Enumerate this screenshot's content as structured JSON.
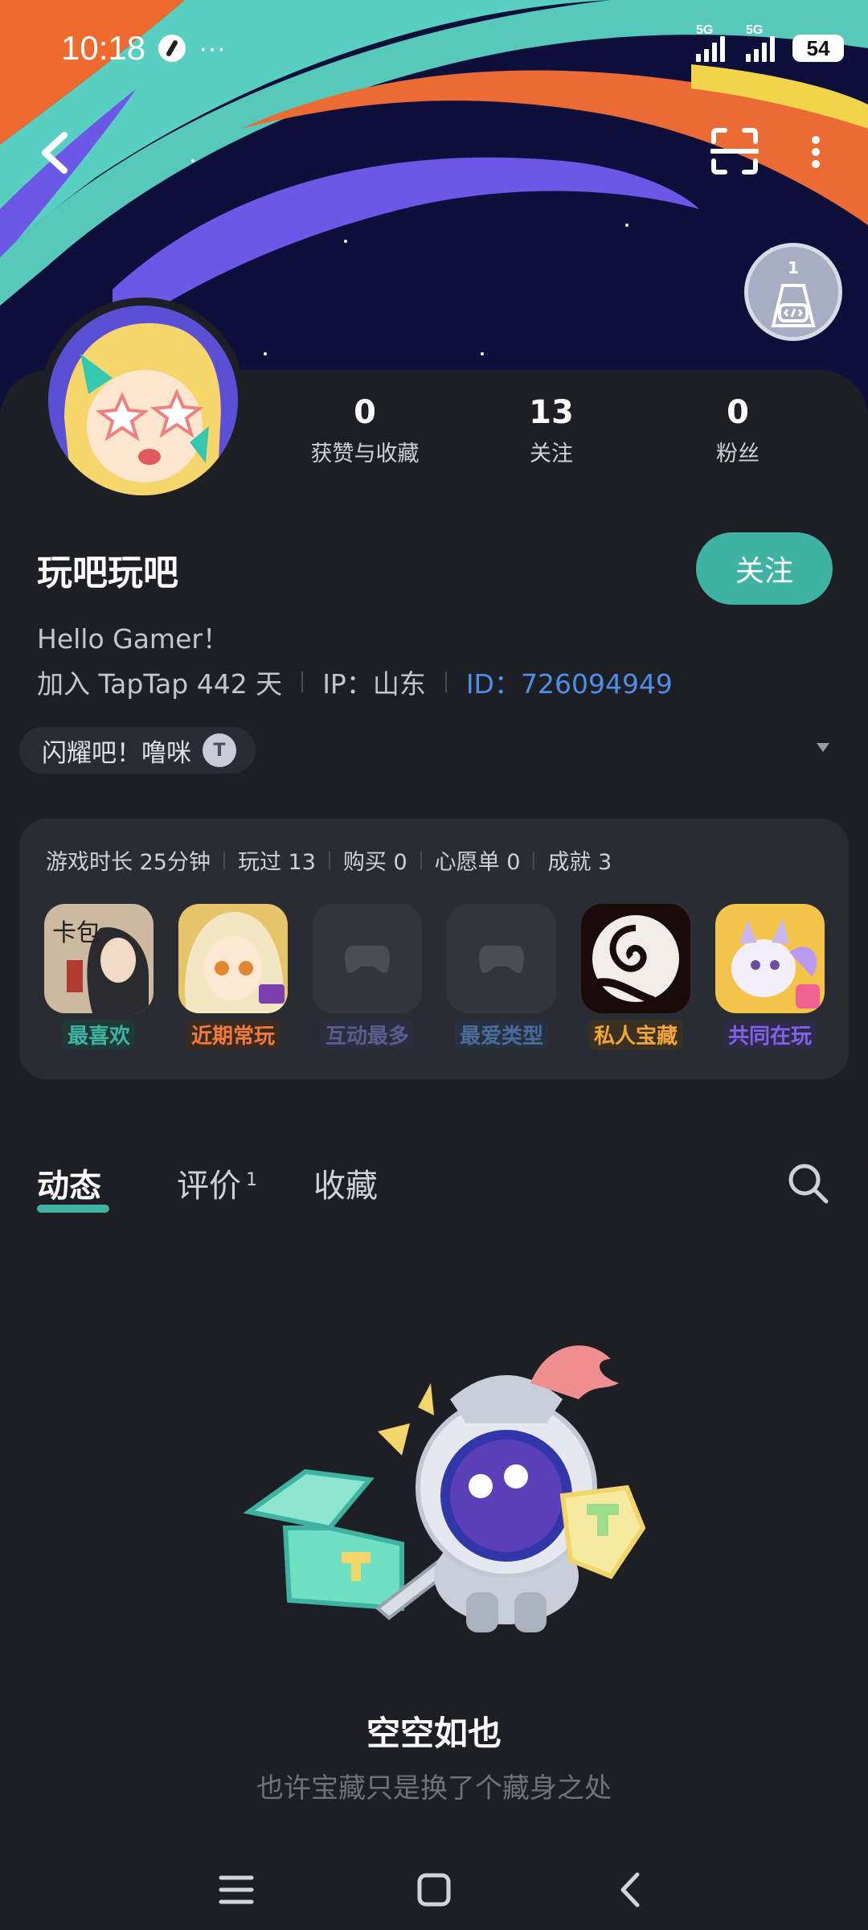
{
  "status_bar": {
    "time": "10:18",
    "more": "···",
    "sim1_tag": "5G",
    "sim2_tag": "5G",
    "battery": "54"
  },
  "badge": {
    "level": "1"
  },
  "stats": [
    {
      "value": "0",
      "label": "获赞与收藏"
    },
    {
      "value": "13",
      "label": "关注"
    },
    {
      "value": "0",
      "label": "粉丝"
    }
  ],
  "profile": {
    "name": "玩吧玩吧",
    "follow_label": "关注",
    "bio": "Hello Gamer！",
    "joined": "加入 TapTap 442 天",
    "ip": "IP：山东",
    "id": "ID：726094949",
    "title_pill": "闪耀吧！噜咪",
    "title_icon": "T"
  },
  "games_panel": {
    "stats": [
      "游戏时长 25分钟",
      "玩过 13",
      "购买 0",
      "心愿单 0",
      "成就 3"
    ],
    "items": [
      {
        "label": "最喜欢",
        "color": "#3fb3a2",
        "bg": "#1f3a36"
      },
      {
        "label": "近期常玩",
        "color": "#f07a3c",
        "bg": "#3a2a22"
      },
      {
        "label": "互动最多",
        "color": "#5a5d8c",
        "bg": "#2c2e3f"
      },
      {
        "label": "最爱类型",
        "color": "#4b6b9a",
        "bg": "#27303f"
      },
      {
        "label": "私人宝藏",
        "color": "#f2a53a",
        "bg": "#3a3122"
      },
      {
        "label": "共同在玩",
        "color": "#7c63e8",
        "bg": "#2f2a45"
      }
    ]
  },
  "tabs": [
    {
      "label": "动态"
    },
    {
      "label": "评价",
      "count": "1"
    },
    {
      "label": "收藏"
    }
  ],
  "empty_state": {
    "title": "空空如也",
    "subtitle": "也许宝藏只是换了个藏身之处"
  },
  "colors": {
    "accent": "#3fb3a2",
    "id_link": "#4f8fe8"
  }
}
